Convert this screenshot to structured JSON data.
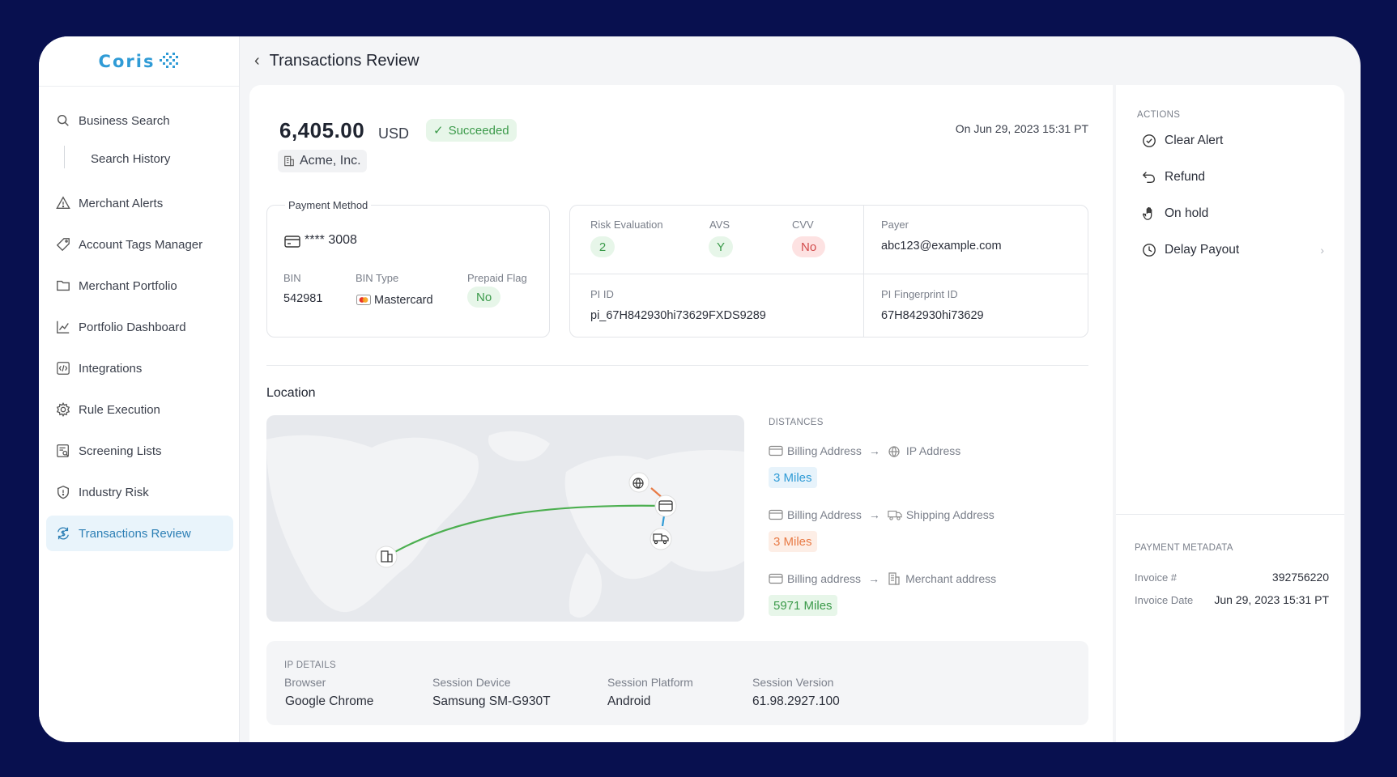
{
  "brand": {
    "name": "Coris",
    "accent": "#2f9bd6"
  },
  "sidebar": {
    "items": [
      {
        "label": "Business Search",
        "icon": "search-icon"
      },
      {
        "label": "Search History",
        "icon": ""
      },
      {
        "label": "Merchant Alerts",
        "icon": "warning-icon"
      },
      {
        "label": "Account Tags Manager",
        "icon": "tag-icon"
      },
      {
        "label": "Merchant Portfolio",
        "icon": "folder-icon"
      },
      {
        "label": "Portfolio Dashboard",
        "icon": "chart-icon"
      },
      {
        "label": "Integrations",
        "icon": "code-icon"
      },
      {
        "label": "Rule Execution",
        "icon": "gear-icon"
      },
      {
        "label": "Screening Lists",
        "icon": "list-search-icon"
      },
      {
        "label": "Industry Risk",
        "icon": "shield-icon"
      },
      {
        "label": "Transactions Review",
        "icon": "dollar-cycle-icon",
        "active": true
      }
    ]
  },
  "header": {
    "title": "Transactions Review"
  },
  "transaction": {
    "amount": "6,405.00",
    "currency": "USD",
    "status": "Succeeded",
    "date": "On Jun 29, 2023 15:31 PT",
    "company": "Acme, Inc."
  },
  "payment_method": {
    "title": "Payment Method",
    "card": "**** 3008",
    "bin_label": "BIN",
    "bin": "542981",
    "bin_type_label": "BIN Type",
    "bin_type": "Mastercard",
    "prepaid_label": "Prepaid Flag",
    "prepaid": "No"
  },
  "risk": {
    "risk_label": "Risk Evaluation",
    "risk_value": "2",
    "avs_label": "AVS",
    "avs_value": "Y",
    "cvv_label": "CVV",
    "cvv_value": "No",
    "payer_label": "Payer",
    "payer_value": "abc123@example.com",
    "pi_id_label": "PI ID",
    "pi_id_value": "pi_67H842930hi73629FXDS9289",
    "fingerprint_label": "PI Fingerprint ID",
    "fingerprint_value": "67H842930hi73629"
  },
  "location": {
    "title": "Location",
    "distances_head": "DISTANCES",
    "rows": [
      {
        "from": "Billing Address",
        "to": "IP Address",
        "miles": "3 Miles",
        "color": "#2f9bd6",
        "bg": "#e7f3fb"
      },
      {
        "from": "Billing Address",
        "to": "Shipping Address",
        "miles": "3 Miles",
        "color": "#e87a45",
        "bg": "#fdeee6"
      },
      {
        "from": "Billing address",
        "to": "Merchant address",
        "miles": "5971 Miles",
        "color": "#3b9a4a",
        "bg": "#e7f6e9"
      }
    ]
  },
  "ip_details": {
    "head": "IP DETAILS",
    "fields": [
      {
        "label": "Browser",
        "value": "Google Chrome"
      },
      {
        "label": "Session Device",
        "value": "Samsung SM-G930T"
      },
      {
        "label": "Session Platform",
        "value": "Android"
      },
      {
        "label": "Session Version",
        "value": "61.98.2927.100"
      }
    ]
  },
  "actions": {
    "head": "ACTIONS",
    "items": [
      {
        "label": "Clear Alert",
        "icon": "check-circle-icon"
      },
      {
        "label": "Refund",
        "icon": "undo-icon"
      },
      {
        "label": "On hold",
        "icon": "hand-icon"
      },
      {
        "label": "Delay Payout",
        "icon": "clock-icon"
      }
    ]
  },
  "payment_metadata": {
    "head": "PAYMENT METADATA",
    "invoice_label": "Invoice #",
    "invoice_value": "392756220",
    "invoice_date_label": "Invoice Date",
    "invoice_date_value": "Jun 29, 2023 15:31 PT"
  }
}
